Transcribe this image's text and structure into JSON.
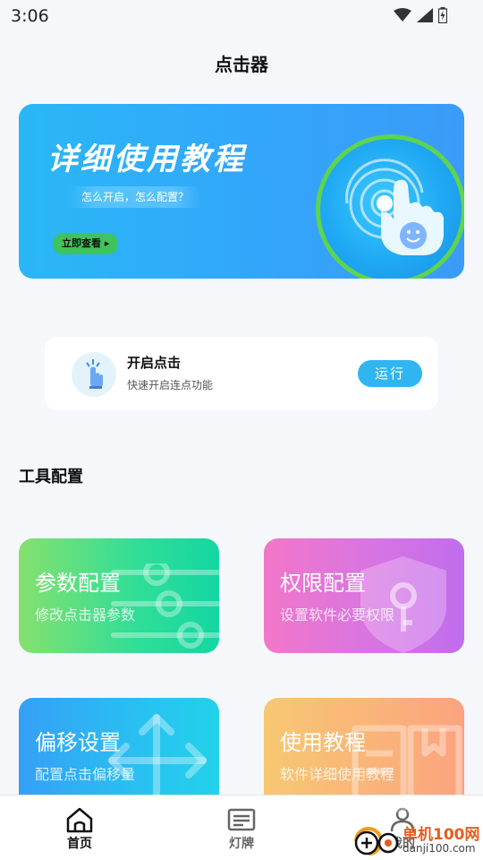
{
  "status_bar": {
    "time": "3:06"
  },
  "app": {
    "title": "点击器"
  },
  "banner": {
    "title": "详细使用教程",
    "subtitle": "怎么开启，怎么配置？",
    "button_label": "立即查看 ▸"
  },
  "run_card": {
    "title": "开启点击",
    "subtitle": "快速开启连点功能",
    "button_label": "运行"
  },
  "tools_section": {
    "title": "工具配置",
    "cards": [
      {
        "title": "参数配置",
        "subtitle": "修改点击器参数"
      },
      {
        "title": "权限配置",
        "subtitle": "设置软件必要权限"
      },
      {
        "title": "偏移设置",
        "subtitle": "配置点击偏移量"
      },
      {
        "title": "使用教程",
        "subtitle": "软件详细使用教程"
      }
    ]
  },
  "tab_bar": {
    "tabs": [
      {
        "label": "首页",
        "icon": "home-icon",
        "active": true
      },
      {
        "label": "灯牌",
        "icon": "led-sign-icon",
        "active": false
      },
      {
        "label": "我的",
        "icon": "profile-icon",
        "active": false
      }
    ]
  },
  "watermark": {
    "brand": "单机100网",
    "url": "danji100.com"
  },
  "colors": {
    "accent": "#30b5f0",
    "banner_bg": "#34a4fb",
    "green_button": "#3ec45a",
    "card_params": "#2fde98",
    "card_permission": "#d574e4",
    "card_offset": "#29c0f1",
    "card_tutorial": "#fab27a"
  }
}
